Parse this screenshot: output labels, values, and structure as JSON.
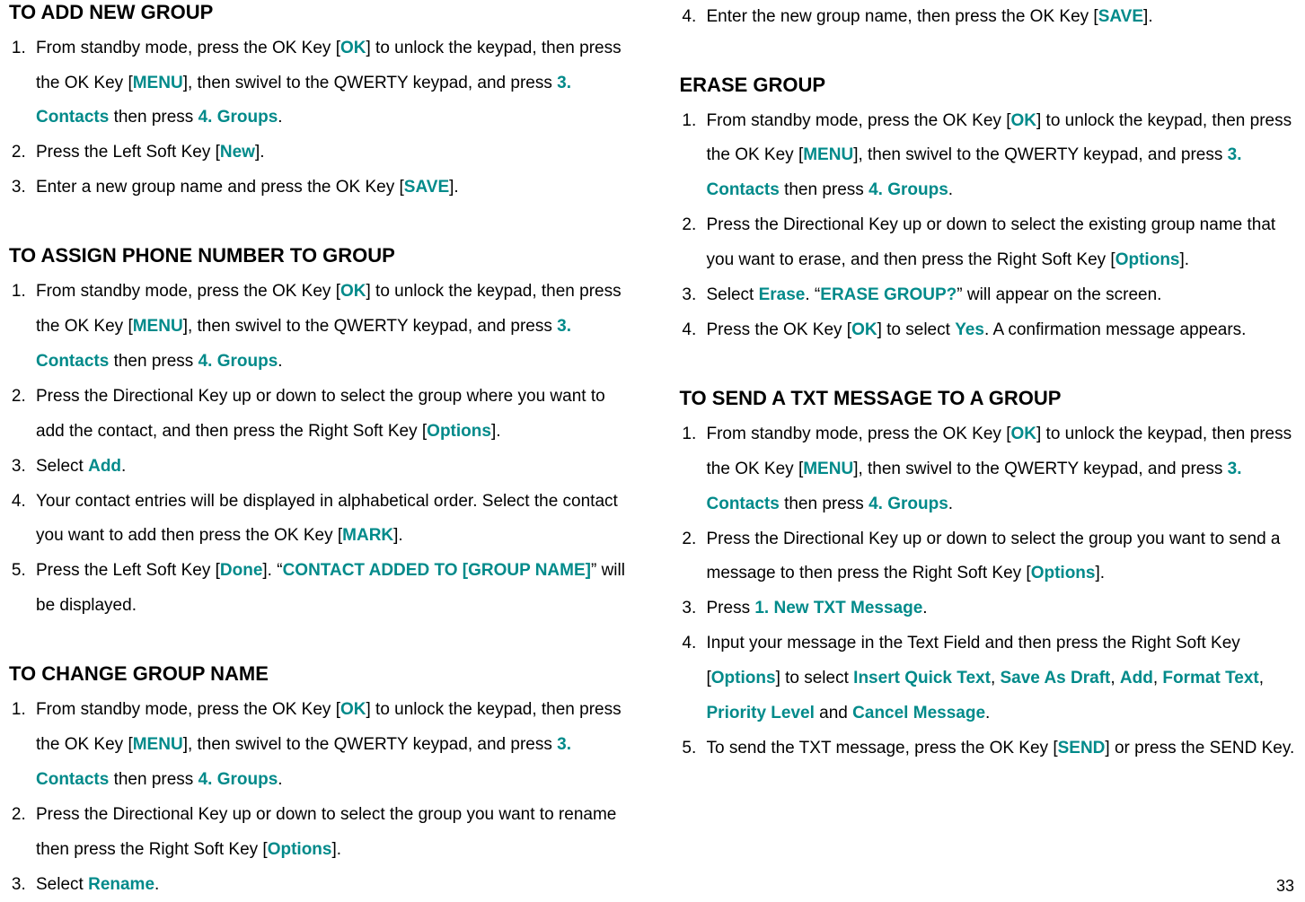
{
  "left": {
    "section1": {
      "heading": "TO ADD NEW GROUP",
      "items": {
        "i1_p1": "From standby mode, press the OK Key [",
        "i1_ok": "OK",
        "i1_p2": "] to unlock the keypad, then press the OK Key [",
        "i1_menu": "MENU",
        "i1_p3": "], then swivel to the QWERTY keypad, and press ",
        "i1_contacts": "3. Contacts",
        "i1_p4": " then press ",
        "i1_groups": "4. Groups",
        "i1_p5": ".",
        "i2_p1": "Press the Left Soft Key [",
        "i2_new": "New",
        "i2_p2": "].",
        "i3_p1": "Enter a new group name and press the OK Key [",
        "i3_save": "SAVE",
        "i3_p2": "]."
      }
    },
    "section2": {
      "heading": "TO ASSIGN PHONE NUMBER TO GROUP",
      "items": {
        "i1_p1": "From standby mode, press the OK Key [",
        "i1_ok": "OK",
        "i1_p2": "] to unlock the keypad, then press the OK Key [",
        "i1_menu": "MENU",
        "i1_p3": "], then swivel to the QWERTY keypad, and press ",
        "i1_contacts": "3. Contacts",
        "i1_p4": " then press ",
        "i1_groups": "4. Groups",
        "i1_p5": ".",
        "i2_p1": "Press the Directional Key up or down to select the group where you want to add the contact, and then press the Right Soft Key [",
        "i2_options": "Options",
        "i2_p2": "].",
        "i3_p1": "Select ",
        "i3_add": "Add",
        "i3_p2": ".",
        "i4_p1": "Your contact entries will be displayed in alphabetical order. Select the contact you want to add then press the OK Key [",
        "i4_mark": "MARK",
        "i4_p2": "].",
        "i5_p1": "Press the Left Soft Key [",
        "i5_done": "Done",
        "i5_p2": "]. “",
        "i5_msg": "CONTACT ADDED TO [GROUP NAME]",
        "i5_p3": "” will be displayed."
      }
    },
    "section3": {
      "heading": "TO CHANGE GROUP NAME",
      "items": {
        "i1_p1": "From standby mode, press the OK Key [",
        "i1_ok": "OK",
        "i1_p2": "] to unlock the keypad, then press the OK Key [",
        "i1_menu": "MENU",
        "i1_p3": "], then swivel to the QWERTY keypad, and press ",
        "i1_contacts": "3. Contacts",
        "i1_p4": " then press ",
        "i1_groups": "4. Groups",
        "i1_p5": ".",
        "i2_p1": "Press the Directional Key up or down to select the group you want to rename then press the Right Soft Key [",
        "i2_options": "Options",
        "i2_p2": "].",
        "i3_p1": "Select ",
        "i3_rename": "Rename",
        "i3_p2": "."
      }
    }
  },
  "right": {
    "cont": {
      "i4_p1": "Enter the new group name, then press the OK Key [",
      "i4_save": "SAVE",
      "i4_p2": "]."
    },
    "section4": {
      "heading": "ERASE GROUP",
      "items": {
        "i1_p1": "From standby mode, press the OK Key [",
        "i1_ok": "OK",
        "i1_p2": "] to unlock the keypad, then press the OK Key [",
        "i1_menu": "MENU",
        "i1_p3": "], then swivel to the QWERTY keypad, and press ",
        "i1_contacts": "3. Contacts",
        "i1_p4": " then press ",
        "i1_groups": "4. Groups",
        "i1_p5": ".",
        "i2_p1": "Press the Directional Key up or down to select the existing group name that you want to erase, and then press the Right Soft Key [",
        "i2_options": "Options",
        "i2_p2": "].",
        "i3_p1": "Select ",
        "i3_erase": "Erase",
        "i3_p2": ". “",
        "i3_msg": "ERASE GROUP?",
        "i3_p3": "” will appear on the screen.",
        "i4_p1": "Press the OK Key [",
        "i4_ok": "OK",
        "i4_p2": "] to select ",
        "i4_yes": "Yes",
        "i4_p3": ". A confirmation message appears."
      }
    },
    "section5": {
      "heading": "TO SEND A TXT MESSAGE TO A GROUP",
      "items": {
        "i1_p1": "From standby mode, press the OK Key [",
        "i1_ok": "OK",
        "i1_p2": "] to unlock the keypad, then press the OK Key [",
        "i1_menu": "MENU",
        "i1_p3": "], then swivel to the QWERTY keypad, and press ",
        "i1_contacts": "3. Contacts",
        "i1_p4": " then press ",
        "i1_groups": "4. Groups",
        "i1_p5": ".",
        "i2_p1": "Press the Directional Key up or down to select the group you want to send a message to then press the Right Soft Key [",
        "i2_options": "Options",
        "i2_p2": "].",
        "i3_p1": "Press ",
        "i3_newtxt": "1. New TXT Message",
        "i3_p2": ".",
        "i4_p1": "Input your message in the Text Field and then press the Right Soft Key [",
        "i4_options": "Options",
        "i4_p2": "] to select ",
        "i4_o1": "Insert Quick Text",
        "i4_c1": ", ",
        "i4_o2": "Save As Draft",
        "i4_c2": ", ",
        "i4_o3": "Add",
        "i4_c3": ", ",
        "i4_o4": "Format Text",
        "i4_c4": ", ",
        "i4_o5": "Priority Level",
        "i4_c5": " and ",
        "i4_o6": "Cancel Message",
        "i4_p3": ".",
        "i5_p1": "To send the TXT message, press the OK Key [",
        "i5_send": "SEND",
        "i5_p2": "] or press the SEND Key."
      }
    }
  },
  "page_number": "33"
}
